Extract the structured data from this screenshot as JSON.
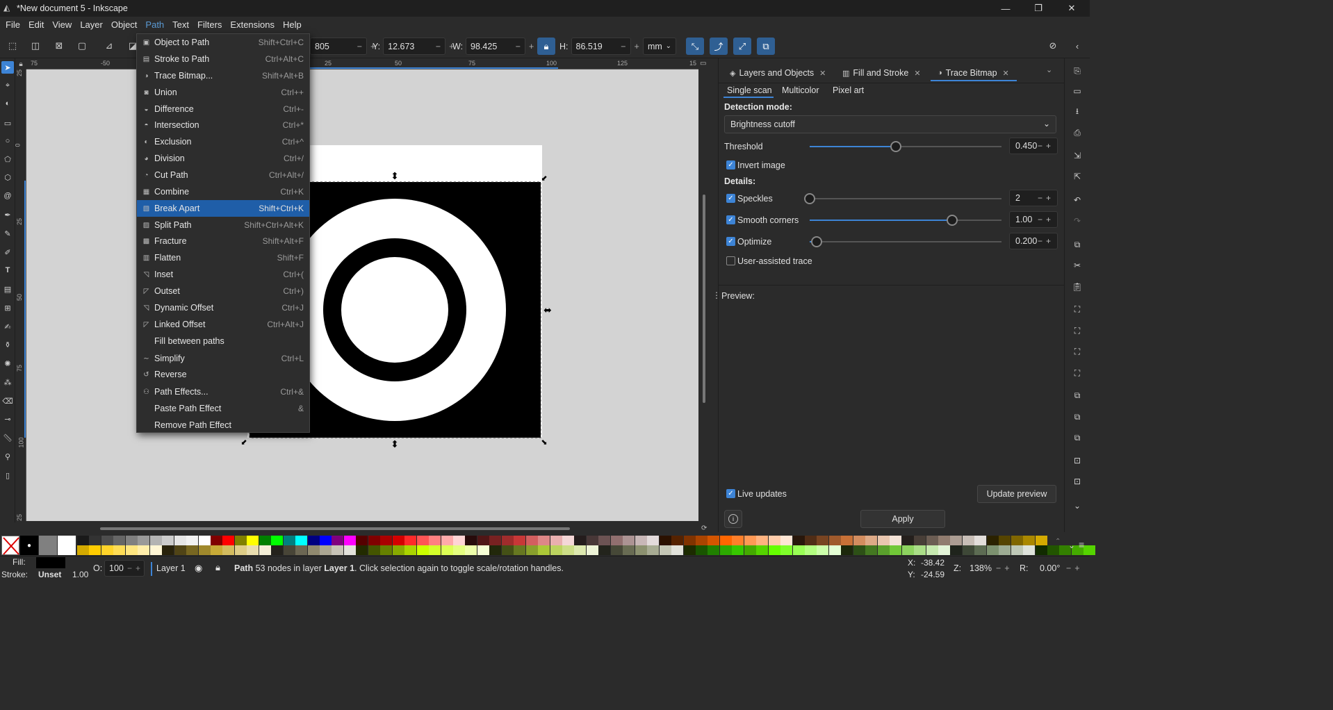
{
  "window": {
    "title": "*New document 5 - Inkscape",
    "min": "—",
    "max": "❐",
    "close": "✕"
  },
  "menubar": [
    "File",
    "Edit",
    "View",
    "Layer",
    "Object",
    "Path",
    "Text",
    "Filters",
    "Extensions",
    "Help"
  ],
  "toolbar": {
    "x_value": "805",
    "y_label": "Y:",
    "y_value": "12.673",
    "w_label": "W:",
    "w_value": "98.425",
    "h_label": "H:",
    "h_value": "86.519",
    "unit": "mm",
    "minus": "−",
    "plus": "+"
  },
  "ruler": {
    "h_labels": [
      "75",
      "-50",
      "25",
      "50",
      "75",
      "100",
      "125",
      "15"
    ],
    "v_labels": [
      "25",
      "0",
      "25",
      "50",
      "75",
      "100",
      "25"
    ]
  },
  "path_menu": [
    {
      "label": "Object to Path",
      "shortcut": "Shift+Ctrl+C",
      "icon": "object-to-path-icon"
    },
    {
      "label": "Stroke to Path",
      "shortcut": "Ctrl+Alt+C",
      "icon": "stroke-to-path-icon"
    },
    {
      "label": "Trace Bitmap...",
      "shortcut": "Shift+Alt+B",
      "icon": "trace-bitmap-icon"
    },
    {
      "label": "Union",
      "shortcut": "Ctrl++",
      "icon": "union-icon"
    },
    {
      "label": "Difference",
      "shortcut": "Ctrl+-",
      "icon": "difference-icon"
    },
    {
      "label": "Intersection",
      "shortcut": "Ctrl+*",
      "icon": "intersection-icon"
    },
    {
      "label": "Exclusion",
      "shortcut": "Ctrl+^",
      "icon": "exclusion-icon"
    },
    {
      "label": "Division",
      "shortcut": "Ctrl+/",
      "icon": "division-icon"
    },
    {
      "label": "Cut Path",
      "shortcut": "Ctrl+Alt+/",
      "icon": "cut-path-icon"
    },
    {
      "label": "Combine",
      "shortcut": "Ctrl+K",
      "icon": "combine-icon"
    },
    {
      "label": "Break Apart",
      "shortcut": "Shift+Ctrl+K",
      "icon": "break-apart-icon",
      "highlighted": true
    },
    {
      "label": "Split Path",
      "shortcut": "Shift+Ctrl+Alt+K",
      "icon": "split-path-icon"
    },
    {
      "label": "Fracture",
      "shortcut": "Shift+Alt+F",
      "icon": "fracture-icon"
    },
    {
      "label": "Flatten",
      "shortcut": "Shift+F",
      "icon": "flatten-icon"
    },
    {
      "label": "Inset",
      "shortcut": "Ctrl+(",
      "icon": "inset-icon"
    },
    {
      "label": "Outset",
      "shortcut": "Ctrl+)",
      "icon": "outset-icon"
    },
    {
      "label": "Dynamic Offset",
      "shortcut": "Ctrl+J",
      "icon": "dynamic-offset-icon"
    },
    {
      "label": "Linked Offset",
      "shortcut": "Ctrl+Alt+J",
      "icon": "linked-offset-icon"
    },
    {
      "label": "Fill between paths",
      "shortcut": "",
      "icon": ""
    },
    {
      "label": "Simplify",
      "shortcut": "Ctrl+L",
      "icon": "simplify-icon"
    },
    {
      "label": "Reverse",
      "shortcut": "",
      "icon": "reverse-icon"
    },
    {
      "label": "Path Effects...",
      "shortcut": "Ctrl+&",
      "icon": "path-effects-icon"
    },
    {
      "label": "Paste Path Effect",
      "shortcut": "&",
      "icon": ""
    },
    {
      "label": "Remove Path Effect",
      "shortcut": "",
      "icon": ""
    }
  ],
  "dock": {
    "tabs": [
      {
        "label": "Layers and Objects",
        "close": "✕"
      },
      {
        "label": "Fill and Stroke",
        "close": "✕"
      },
      {
        "label": "Trace Bitmap",
        "close": "✕"
      }
    ],
    "subtabs": [
      "Single scan",
      "Multicolor",
      "Pixel art"
    ],
    "detection_label": "Detection mode:",
    "detection_value": "Brightness cutoff",
    "threshold_label": "Threshold",
    "threshold_value": "0.450",
    "threshold_level": 0.45,
    "invert_label": "Invert image",
    "details_label": "Details:",
    "speckles_label": "Speckles",
    "speckles_value": "2",
    "smooth_label": "Smooth corners",
    "smooth_value": "1.00",
    "optimize_label": "Optimize",
    "optimize_value": "0.200",
    "assisted_label": "User-assisted trace",
    "preview_label": "Preview:",
    "live_label": "Live updates",
    "update_button": "Update preview",
    "apply_button": "Apply",
    "info": "i"
  },
  "status": {
    "fill_label": "Fill:",
    "stroke_label": "Stroke:",
    "stroke_value": "Unset",
    "stroke_width": "1.00",
    "opacity_label": "O:",
    "opacity_value": "100",
    "layer": "Layer 1",
    "message_bold": "Path",
    "message": "53 nodes in layer",
    "message_layer": "Layer 1",
    "message_tail": ". Click selection again to toggle scale/rotation handles.",
    "x_label": "X:",
    "x_value": "-38.42",
    "y_label": "Y:",
    "y_value": "-24.59",
    "zoom_label": "Z:",
    "zoom_value": "138%",
    "rot_label": "R:",
    "rot_value": "0.00°"
  },
  "colors": {
    "accent": "#3d84d6",
    "highlight": "#1f5ea8",
    "canvas": "#d3d3d3"
  }
}
